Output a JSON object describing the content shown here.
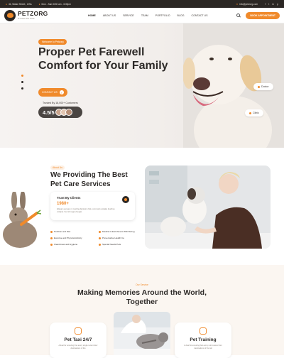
{
  "topbar": {
    "address": "4b, Walse Street , USA",
    "hours": "Mon - Sam 8:30 am - 6:30pm",
    "email": "info@petzorg.com",
    "social": [
      "f",
      "t",
      "in",
      "p"
    ]
  },
  "header": {
    "logo_name": "PETZORG",
    "logo_sub": "A Leave Pet Care",
    "nav": [
      "HOME",
      "ABOUT US",
      "SERVICE",
      "TEAM",
      "PORTFOLIO",
      "BLOG",
      "CONTACT US"
    ],
    "cta": "BOOK APPOINTMENT"
  },
  "hero": {
    "tag": "Welcome to Petzorg",
    "title": "Proper Pet Farewell Comfort for Your Family",
    "button": "CONTACT US",
    "trust": "Trusted By 18,000+ Customers",
    "rating": "4.5/5",
    "chips": [
      "Doctor",
      "Clinic"
    ]
  },
  "about": {
    "tag": "About Us",
    "title": "We Providing The Best Pet Care Services",
    "card_title": "Trust By Clients",
    "card_count": "1980+",
    "card_desc": "Eliquam aenean mi nostling dignissim felis, commodo sodales faucibus volutpat. Sed id magna feugiat.",
    "features": [
      "Nutrition and Diet",
      "Medical & Enrichment With Boring",
      "Exercise and Physical Activity",
      "Preventative Health Ca",
      "Cleanliness and Hygiene",
      "Special Needs Pets"
    ]
  },
  "services": {
    "tag": "Our Service",
    "title": "Making Memories Around the World, Together",
    "cards": [
      {
        "name": "Pet Taxi 24/7",
        "desc": "A dual for ensuring that every single recent door destinations of the"
      },
      {
        "name": "Pet Training",
        "desc": "A dual for ensuring that every unit receive from destinations of the tail"
      }
    ]
  },
  "colors": {
    "accent": "#f08a2b",
    "dark": "#2b2724"
  }
}
